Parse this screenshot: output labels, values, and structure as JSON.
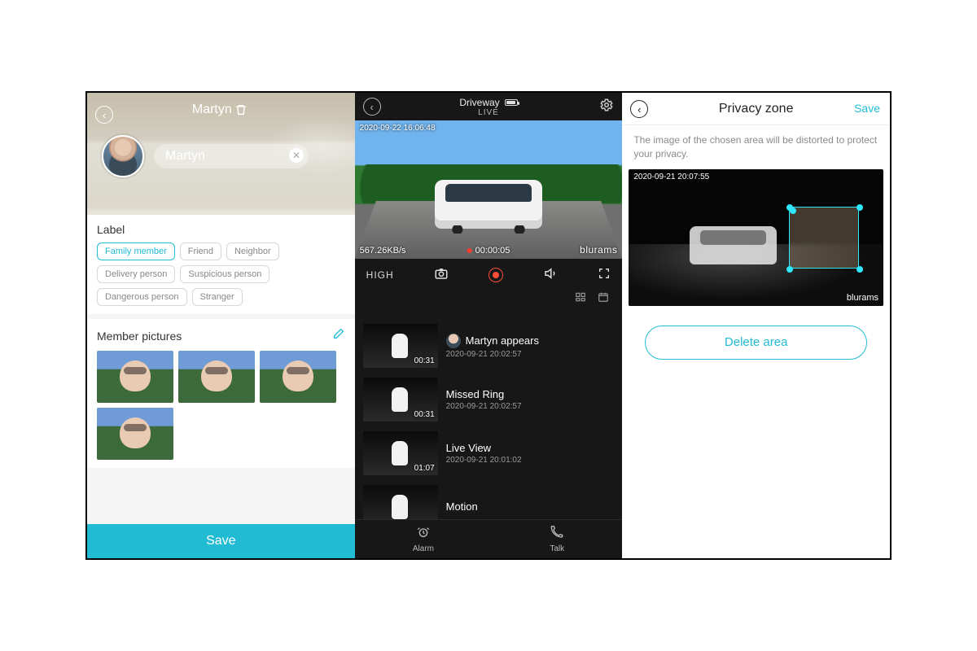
{
  "panel1": {
    "title": "Martyn",
    "name_input": "Martyn",
    "label_header": "Label",
    "labels": [
      "Family member",
      "Friend",
      "Neighbor",
      "Delivery person",
      "Suspicious person",
      "Dangerous person",
      "Stranger"
    ],
    "label_selected": 0,
    "pictures_header": "Member pictures",
    "picture_count": 4,
    "save": "Save"
  },
  "panel2": {
    "camera_name": "Driveway",
    "live_label": "LIVE",
    "overlay_timestamp": "2020-09-22   16:06:48",
    "bitrate": "567.26KB/s",
    "rec_elapsed": "00:00:05",
    "brand": "blurams",
    "quality": "HIGH",
    "events": [
      {
        "duration": "00:31",
        "title": "Martyn appears",
        "date": "2020-09-21 20:02:57",
        "has_avatar": true
      },
      {
        "duration": "00:31",
        "title": "Missed Ring",
        "date": "2020-09-21 20:02:57",
        "has_avatar": false
      },
      {
        "duration": "01:07",
        "title": "Live View",
        "date": "2020-09-21 20:01:02",
        "has_avatar": false
      },
      {
        "duration": "",
        "title": "Motion",
        "date": "",
        "has_avatar": false
      }
    ],
    "bottom": {
      "alarm": "Alarm",
      "talk": "Talk"
    }
  },
  "panel3": {
    "title": "Privacy zone",
    "save": "Save",
    "desc": "The image of the chosen area will be distorted to protect your privacy.",
    "timestamp": "2020-09-21   20:07:55",
    "brand": "blurams",
    "delete": "Delete area"
  }
}
